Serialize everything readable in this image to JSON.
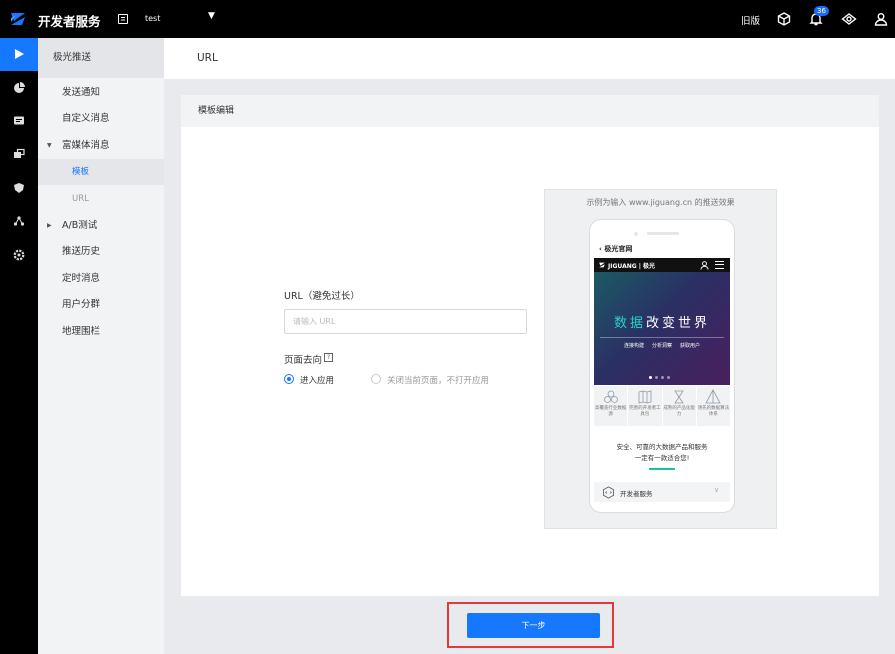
{
  "topbar": {
    "brand": "开发者服务",
    "app_name": "test",
    "old_version": "旧版",
    "notification_count": "36",
    "icons": [
      "logo-icon",
      "app-selector-icon",
      "cube-icon",
      "bell-icon",
      "eye-icon",
      "user-icon"
    ]
  },
  "rail": {
    "items": [
      "push-icon",
      "chart-icon",
      "message-icon",
      "window-icon",
      "shield-icon",
      "network-icon",
      "settings-icon"
    ],
    "active_index": 0,
    "accent": "#1677ff"
  },
  "submenu": {
    "title": "极光推送",
    "items": [
      {
        "label": "发送通知"
      },
      {
        "label": "自定义消息"
      },
      {
        "label": "富媒体消息",
        "expanded": true
      },
      {
        "label": "模板",
        "child": true,
        "selected": true
      },
      {
        "label": "URL",
        "child": true
      },
      {
        "label": "A/B测试",
        "expanded": false
      },
      {
        "label": "推送历史"
      },
      {
        "label": "定时消息"
      },
      {
        "label": "用户分群"
      },
      {
        "label": "地理围栏"
      }
    ]
  },
  "main": {
    "header_title": "URL",
    "card_title": "模板编辑",
    "form": {
      "url_label": "URL（避免过长）",
      "url_placeholder": "请输入 URL",
      "url_value": "",
      "direction_label": "页面去向",
      "help_glyph": "?",
      "options": [
        {
          "label": "进入应用",
          "checked": true
        },
        {
          "label": "关闭当前页面，不打开应用",
          "checked": false
        }
      ]
    },
    "preview": {
      "caption": "示例为输入 www.jiguang.cn 的推送效果",
      "site_title": "极光官网",
      "site_logo": "JIGUANG | 极光",
      "hero_highlight": "数据",
      "hero_rest": "改变世界",
      "hero_links": [
        "连接构建",
        "分析洞察",
        "获取用户"
      ],
      "features": [
        {
          "icon": "cubes-icon",
          "text": "高覆盖行业数据源"
        },
        {
          "icon": "map-icon",
          "text": "完善的开发者工具包"
        },
        {
          "icon": "hourglass-icon",
          "text": "成熟的产品化能力"
        },
        {
          "icon": "pyramid-icon",
          "text": "领先的数据算法体系"
        }
      ],
      "slogan_line1": "安全、可靠的大数据产品和服务",
      "slogan_line2": "一定有一款适合您!",
      "footer_text": "开发者服务"
    },
    "next_button": "下一步"
  }
}
